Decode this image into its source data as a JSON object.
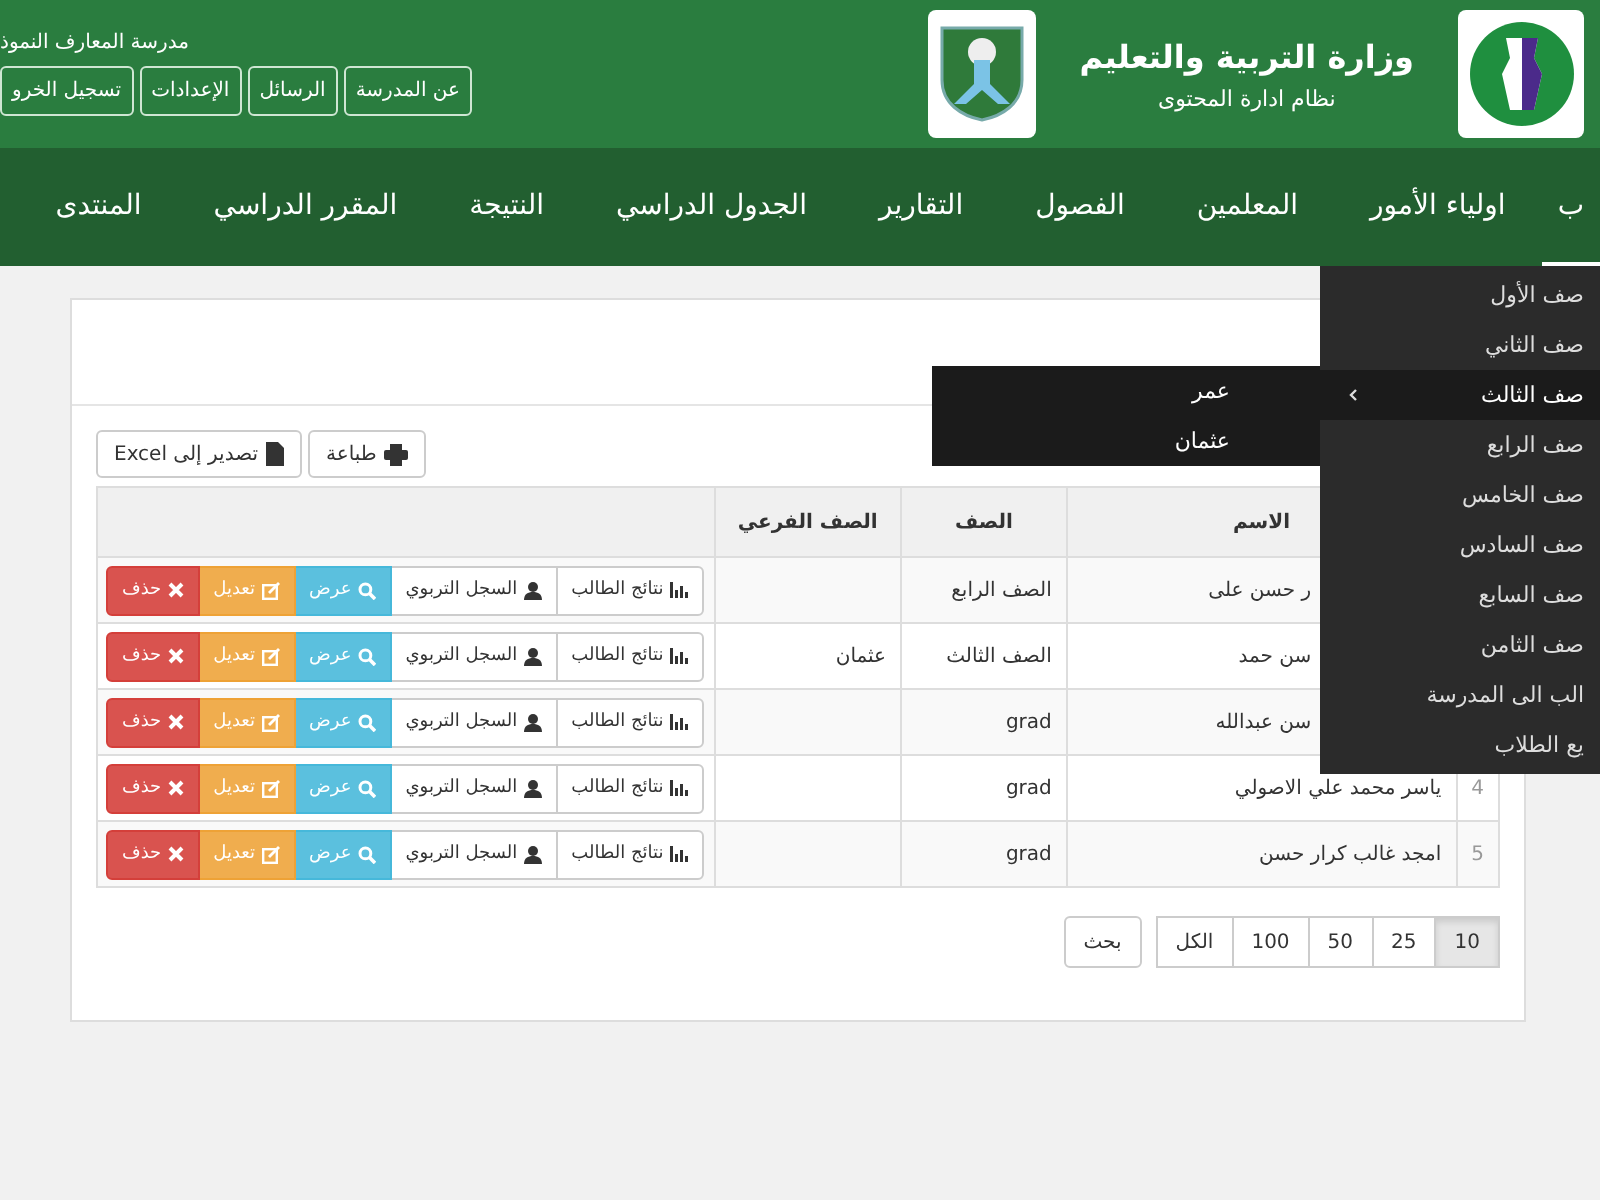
{
  "header": {
    "title": "وزارة التربية والتعليم",
    "subtitle": "نظام ادارة المحتوى",
    "school_name": "مدرسة المعارف النموذ",
    "top_links": [
      "عن المدرسة",
      "الرسائل",
      "الإعدادات",
      "تسجيل الخرو"
    ]
  },
  "nav": {
    "items": [
      {
        "label": "ب",
        "selected": true
      },
      {
        "label": "اولياء الأمور",
        "selected": false
      },
      {
        "label": "المعلمين",
        "selected": false
      },
      {
        "label": "الفصول",
        "selected": false
      },
      {
        "label": "التقارير",
        "selected": false
      },
      {
        "label": "الجدول الدراسي",
        "selected": false
      },
      {
        "label": "النتيجة",
        "selected": false
      },
      {
        "label": "المقرر الدراسي",
        "selected": false
      },
      {
        "label": "المنتدى",
        "selected": false
      }
    ]
  },
  "toolbar": [
    {
      "label": "طباعة",
      "kind": "print"
    },
    {
      "label": "تصدير إلى Excel",
      "kind": "excel"
    }
  ],
  "table": {
    "columns": [
      "الاسم",
      "الصف",
      "الصف الفرعي"
    ],
    "rows": [
      {
        "name": "ر حسن على",
        "grade": "الصف الرابع",
        "actions": [
          {
            "label": "نتائج الطالب",
            "kind": "results"
          },
          {
            "label": "السجل التربوي",
            "kind": "record"
          },
          {
            "label": "عرض",
            "kind": "view"
          },
          {
            "label": "تعديل",
            "kind": "edit"
          },
          {
            "label": "حذف",
            "kind": "delete"
          }
        ]
      },
      {
        "name": "سن حمد",
        "grade": "الصف الثالث",
        "subclass": "عثمان",
        "actions": [
          {
            "label": "نتائج الطالب",
            "kind": "results"
          },
          {
            "label": "السجل التربوي",
            "kind": "record"
          },
          {
            "label": "عرض",
            "kind": "view"
          },
          {
            "label": "تعديل",
            "kind": "edit"
          },
          {
            "label": "حذف",
            "kind": "delete"
          }
        ]
      },
      {
        "name": "سن عبدالله",
        "grade": "grad",
        "actions": [
          {
            "label": "نتائج الطالب",
            "kind": "results"
          },
          {
            "label": "السجل التربوي",
            "kind": "record"
          },
          {
            "label": "عرض",
            "kind": "view"
          },
          {
            "label": "تعديل",
            "kind": "edit"
          },
          {
            "label": "حذف",
            "kind": "delete"
          }
        ]
      },
      {
        "number": "4",
        "name": "ياسر محمد علي الاصولي",
        "grade": "grad",
        "actions": [
          {
            "label": "نتائج الطالب",
            "kind": "results"
          },
          {
            "label": "السجل التربوي",
            "kind": "record"
          },
          {
            "label": "عرض",
            "kind": "view"
          },
          {
            "label": "تعديل",
            "kind": "edit"
          },
          {
            "label": "حذف",
            "kind": "delete"
          }
        ]
      },
      {
        "number": "5",
        "name": "امجد غالب كرار حسن",
        "grade": "grad",
        "actions": [
          {
            "label": "نتائج الطالب",
            "kind": "results"
          },
          {
            "label": "السجل التربوي",
            "kind": "record"
          },
          {
            "label": "عرض",
            "kind": "view"
          },
          {
            "label": "تعديل",
            "kind": "edit"
          },
          {
            "label": "حذف",
            "kind": "delete"
          }
        ]
      }
    ]
  },
  "pagination": {
    "pages": [
      {
        "label": "10",
        "selected": true
      },
      {
        "label": "25",
        "selected": false
      },
      {
        "label": "50",
        "selected": false
      },
      {
        "label": "100",
        "selected": false
      },
      {
        "label": "الكل",
        "selected": false
      }
    ],
    "search": "بحث"
  },
  "dropdown": {
    "items": [
      {
        "label": "صف الأول",
        "selected": false
      },
      {
        "label": "صف الثاني",
        "selected": false
      },
      {
        "label": "صف الثالث",
        "selected": true,
        "submenu": [
          "عمر",
          "عثمان"
        ]
      },
      {
        "label": "صف الرابع",
        "selected": false
      },
      {
        "label": "صف الخامس",
        "selected": false
      },
      {
        "label": "صف السادس",
        "selected": false
      },
      {
        "label": "صف السابع",
        "selected": false
      },
      {
        "label": "صف الثامن",
        "selected": false
      },
      {
        "label": "الب الى المدرسة",
        "selected": false
      },
      {
        "label": "يع الطلاب",
        "selected": false
      }
    ]
  }
}
